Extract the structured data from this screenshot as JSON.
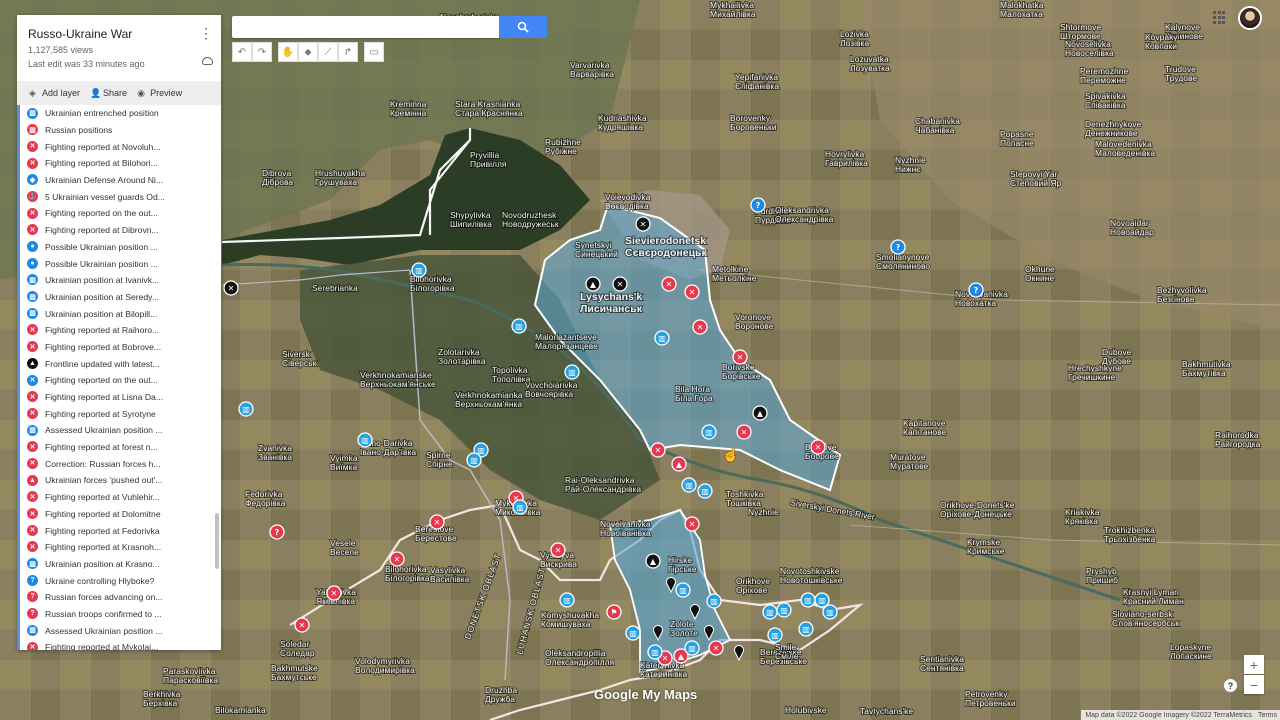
{
  "map_title": "Russo-Ukraine War",
  "views": "1,127,585 views",
  "last_edit": "Last edit was 33 minutes ago",
  "actions": {
    "add_layer": "Add layer",
    "share": "Share",
    "preview": "Preview"
  },
  "search": {
    "placeholder": ""
  },
  "legend_items": [
    {
      "label": "Ukrainian entrenched position",
      "color": "#1e88e5",
      "icon": "fort-icon"
    },
    {
      "label": "Russian positions",
      "color": "#e53950",
      "icon": "fort-icon"
    },
    {
      "label": "Fighting reported at Novoluh...",
      "color": "#e53950",
      "icon": "crossed-swords-icon"
    },
    {
      "label": "Fighting reported at Bilohori...",
      "color": "#e53950",
      "icon": "crossed-swords-icon"
    },
    {
      "label": "Ukrainian Defense Around Ni...",
      "color": "#1e88e5",
      "icon": "shield-icon"
    },
    {
      "label": "5 Ukrainian vessel guards Od...",
      "color": "#e53950",
      "icon": "ship-icon"
    },
    {
      "label": "Fighting reported on the out...",
      "color": "#e53950",
      "icon": "crossed-swords-icon"
    },
    {
      "label": "Fighting reported at Dibrovn...",
      "color": "#e53950",
      "icon": "crossed-swords-icon"
    },
    {
      "label": "Possible Ukrainian position ...",
      "color": "#1e88e5",
      "icon": "person-icon"
    },
    {
      "label": "Possible Ukrainian position ...",
      "color": "#1e88e5",
      "icon": "person-icon"
    },
    {
      "label": "Ukrainian position at Ivanivk...",
      "color": "#1e88e5",
      "icon": "fort-icon"
    },
    {
      "label": "Ukrainian position at Seredy...",
      "color": "#1e88e5",
      "icon": "fort-icon"
    },
    {
      "label": "Ukrainian position at Bilopill...",
      "color": "#1e88e5",
      "icon": "fort-icon"
    },
    {
      "label": "Fighting reported at Raihoro...",
      "color": "#e53950",
      "icon": "crossed-swords-icon"
    },
    {
      "label": "Fighting reported at Bobrove...",
      "color": "#e53950",
      "icon": "crossed-swords-icon"
    },
    {
      "label": "Frontline updated with latest...",
      "color": "#111111",
      "icon": "warning-icon"
    },
    {
      "label": "Fighting reported on the out...",
      "color": "#1e88e5",
      "icon": "crossed-swords-icon"
    },
    {
      "label": "Fighting reported at Lisna Da...",
      "color": "#e53950",
      "icon": "crossed-swords-icon"
    },
    {
      "label": "Fighting reported at Syrotyne",
      "color": "#e53950",
      "icon": "crossed-swords-icon"
    },
    {
      "label": "Assessed Ukrainian position ...",
      "color": "#1e88e5",
      "icon": "fort-icon"
    },
    {
      "label": "Fighting reported at forest n...",
      "color": "#e53950",
      "icon": "crossed-swords-icon"
    },
    {
      "label": "Correction: Russian forces h...",
      "color": "#e53950",
      "icon": "crossed-swords-icon"
    },
    {
      "label": "Ukrainian forces 'pushed out'...",
      "color": "#e53950",
      "icon": "warning-icon"
    },
    {
      "label": "Fighting reported at Vuhlehir...",
      "color": "#e53950",
      "icon": "crossed-swords-icon"
    },
    {
      "label": "Fighting reported at Dolomitne",
      "color": "#e53950",
      "icon": "crossed-swords-icon"
    },
    {
      "label": "Fighting reported at Fedorivka",
      "color": "#e53950",
      "icon": "crossed-swords-icon"
    },
    {
      "label": "Fighting reported at Krasnoh...",
      "color": "#e53950",
      "icon": "crossed-swords-icon"
    },
    {
      "label": "Ukrainian position at Krasno...",
      "color": "#1e88e5",
      "icon": "fort-icon"
    },
    {
      "label": "Ukraine controlling Hlyboke?",
      "color": "#1e88e5",
      "icon": "question-icon"
    },
    {
      "label": "Russian forces advancing on...",
      "color": "#e53950",
      "icon": "question-icon"
    },
    {
      "label": "Russian troops confirmed to ...",
      "color": "#e53950",
      "icon": "question-icon"
    },
    {
      "label": "Assessed Ukrainian position ...",
      "color": "#1e88e5",
      "icon": "fort-icon"
    },
    {
      "label": "Fighting reported at Mykolai...",
      "color": "#e53950",
      "icon": "crossed-swords-icon"
    }
  ],
  "places": [
    {
      "name": "Mykhailivka",
      "name2": "Михайлівка"
    },
    {
      "name": "Malokhatka",
      "name2": "Малохатка"
    },
    {
      "name": "Shtormove",
      "name2": "Штормове"
    },
    {
      "name": "Varvarivka",
      "name2": "Варварівка"
    },
    {
      "name": "Kalynove",
      "name2": "Калинове"
    },
    {
      "name": "Kovpaky",
      "name2": "Ковпаки"
    },
    {
      "name": "Lozivka",
      "name2": "Лозівка"
    },
    {
      "name": "Novoselivka",
      "name2": "Новоселівка"
    },
    {
      "name": "Lozuvatka",
      "name2": "Лозуватка"
    },
    {
      "name": "Yepifanivka",
      "name2": "Єпіфанівка"
    },
    {
      "name": "Peremozhne",
      "name2": "Переможне"
    },
    {
      "name": "Trudove",
      "name2": "Трудове"
    },
    {
      "name": "Kreminna",
      "name2": "Кремінна"
    },
    {
      "name": "Stara Krasnianka",
      "name2": "Стара Краснянка"
    },
    {
      "name": "Kudriashivka",
      "name2": "Кудряшівка"
    },
    {
      "name": "Borovenky",
      "name2": "Боровеньки"
    },
    {
      "name": "Chabanivka",
      "name2": "Чабанівка"
    },
    {
      "name": "Spivakivka",
      "name2": "Співаківка"
    },
    {
      "name": "Denezhnykove",
      "name2": "Денежникове"
    },
    {
      "name": "Rubizhne",
      "name2": "Рубіжне"
    },
    {
      "name": "Pryvillia",
      "name2": "Привілля"
    },
    {
      "name": "Dibrova",
      "name2": "Діброва"
    },
    {
      "name": "Hrushuvakha",
      "name2": "Грушуваха"
    },
    {
      "name": "Hovrylivka",
      "name2": "Гаврилівка"
    },
    {
      "name": "Nyzhnie",
      "name2": "Нижнє"
    },
    {
      "name": "Popasne",
      "name2": "Попасне"
    },
    {
      "name": "Malovedenivka",
      "name2": "Маловеденівка"
    },
    {
      "name": "Stepovyi Yar",
      "name2": "Степовий Яр"
    },
    {
      "name": "Shypylivka",
      "name2": "Шипилівка"
    },
    {
      "name": "Novodruzhesk",
      "name2": "Новодружеськ"
    },
    {
      "name": "Voievodivka",
      "name2": "Воєводівка"
    },
    {
      "name": "Purdivka",
      "name2": "Пурдівка"
    },
    {
      "name": "Oleksandrivka",
      "name2": "Олександрівка"
    },
    {
      "name": "Novoaidar",
      "name2": "Новоайдар"
    },
    {
      "name": "Synetskyi",
      "name2": "Синецький"
    },
    {
      "name": "Sievierodonetsk",
      "name2": "Сєвєродонецьк"
    },
    {
      "name": "Smolianynove",
      "name2": "Смоляниново"
    },
    {
      "name": "Lysychans'k",
      "name2": "Лисичанськ"
    },
    {
      "name": "Metolkine",
      "name2": "Метьолкіне"
    },
    {
      "name": "Okhune",
      "name2": "Окнине"
    },
    {
      "name": "Novozvanivka",
      "name2": "Новохатка"
    },
    {
      "name": "Bezhyvolivka",
      "name2": "Безгінове"
    },
    {
      "name": "Serebrianka",
      "name2": ""
    },
    {
      "name": "Bilohorivka",
      "name2": "Білогорівка"
    },
    {
      "name": "Voronove",
      "name2": "Воронове"
    },
    {
      "name": "Zolotarivka",
      "name2": "Золотарівка"
    },
    {
      "name": "Siversk",
      "name2": "Сіверськ"
    },
    {
      "name": "Maloriazantseve",
      "name2": "Малорязанцеве"
    },
    {
      "name": "Borivske",
      "name2": "Борівське"
    },
    {
      "name": "Topolivka",
      "name2": "Тополівка"
    },
    {
      "name": "Verkhnokamianske",
      "name2": "Верхньокам'янське"
    },
    {
      "name": "Verkhnokamianka",
      "name2": "Верхньокам'янка"
    },
    {
      "name": "Bila Hora",
      "name2": "Біла Гора"
    },
    {
      "name": "Vovchoiarivka",
      "name2": "Вовчоярівка"
    },
    {
      "name": "Zvanivka",
      "name2": "Званівка"
    },
    {
      "name": "Ivano-Darivka",
      "name2": "Івано-Дар'ївка"
    },
    {
      "name": "Vyimka",
      "name2": "Виїмка"
    },
    {
      "name": "Spirne",
      "name2": "Спірне"
    },
    {
      "name": "Bobrove",
      "name2": "Боброве"
    },
    {
      "name": "Muratove",
      "name2": "Муратове"
    },
    {
      "name": "Kapitanove",
      "name2": "Капітанове"
    },
    {
      "name": "Dubove",
      "name2": "Дубове"
    },
    {
      "name": "Hrechyshkyne",
      "name2": "Гречишкине"
    },
    {
      "name": "Bakhmutivka",
      "name2": "Бахмутівка"
    },
    {
      "name": "Raihorodka",
      "name2": "Райгородка"
    },
    {
      "name": "Rai-Oleksandrivka",
      "name2": "Рай-Олександрівка"
    },
    {
      "name": "Toshkivka",
      "name2": "Тошківка"
    },
    {
      "name": "Nyzhnie",
      "name2": ""
    },
    {
      "name": "Orikhove-Donets'ke",
      "name2": "Оріхове-Донецьке"
    },
    {
      "name": "Kriakivka",
      "name2": "Кряківка"
    },
    {
      "name": "Fedorivka",
      "name2": "Федорівка"
    },
    {
      "name": "Mykolaivka",
      "name2": "Миколаївка"
    },
    {
      "name": "Berestove",
      "name2": "Берестове"
    },
    {
      "name": "Novoivanivka",
      "name2": "Новоіванівка"
    },
    {
      "name": "Hirske",
      "name2": "Гірське"
    },
    {
      "name": "Orikhove",
      "name2": "Оріхове"
    },
    {
      "name": "Novotoshkivske",
      "name2": "Новотошківське"
    },
    {
      "name": "Trokhizbenka",
      "name2": "Трьохізбенка"
    },
    {
      "name": "Veselе",
      "name2": "Веселе"
    },
    {
      "name": "Bilohorivka",
      "name2": "Білогорівка"
    },
    {
      "name": "Vasylivka",
      "name2": "Василівка"
    },
    {
      "name": "Krymske",
      "name2": "Кримське"
    },
    {
      "name": "Pryshyb",
      "name2": "Пришиб"
    },
    {
      "name": "Krasnyi Lyman",
      "name2": "Красний Лиман"
    },
    {
      "name": "Sloviano-serbsk",
      "name2": "Слов'яносербськ"
    },
    {
      "name": "Zolote",
      "name2": "Золоте"
    },
    {
      "name": "Komyshuvakha",
      "name2": "Комишуваха"
    },
    {
      "name": "Vyskryva",
      "name2": "Вискрива"
    },
    {
      "name": "Yakovlivka",
      "name2": "Яковлівка"
    },
    {
      "name": "Soledar",
      "name2": "Соледар"
    },
    {
      "name": "Bakhmutske",
      "name2": "Бахмутське"
    },
    {
      "name": "Volodymyrivka",
      "name2": "Володимирівка"
    },
    {
      "name": "Oleksandropillia",
      "name2": "Олександропілля"
    },
    {
      "name": "Katerynivka",
      "name2": "Катеринівка"
    },
    {
      "name": "Berezivske",
      "name2": "Березівське"
    },
    {
      "name": "Smile",
      "name2": "Сміле"
    },
    {
      "name": "Sentianivka",
      "name2": "Сентянівка"
    },
    {
      "name": "Petrovenky",
      "name2": "Петровеньки"
    },
    {
      "name": "Lopaskyne",
      "name2": "Лопаскине"
    },
    {
      "name": "Paraskoviivka",
      "name2": "Парасковіївка"
    },
    {
      "name": "Berkhivka",
      "name2": "Берхівка"
    },
    {
      "name": "Druzhba",
      "name2": "Дружба"
    },
    {
      "name": "Bilokamianka",
      "name2": ""
    },
    {
      "name": "Holubivske",
      "name2": ""
    },
    {
      "name": "Tavtychans'ke",
      "name2": ""
    },
    {
      "name": "Novohryhorivka",
      "name2": "Новогригорівка"
    }
  ],
  "oblasts": {
    "donetsk": "DONETSK OBLAST",
    "luhansk": "LUHANSK OBLAST"
  },
  "river_label": "Siverskyi Donets River",
  "logo": "Google My Maps",
  "footer": {
    "attribution": "Map data ©2022 Google Imagery ©2022 TerraMetrics",
    "terms": "Terms"
  }
}
